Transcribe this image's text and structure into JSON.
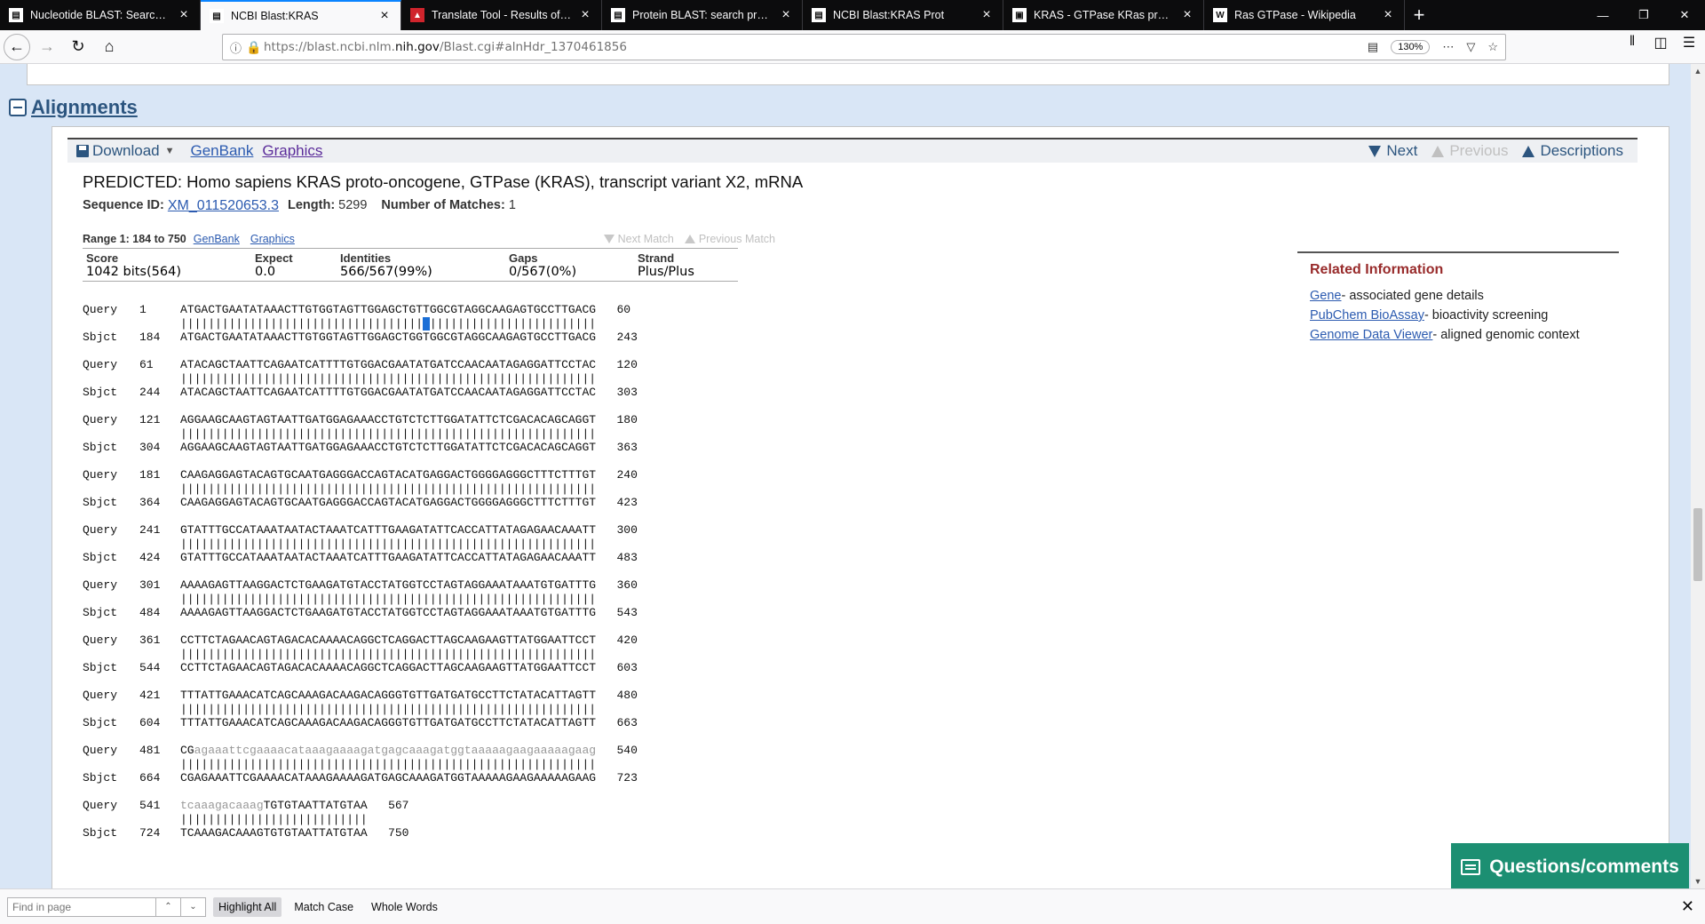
{
  "tabs": [
    {
      "label": "Nucleotide BLAST: Search nucl",
      "icon": "document-icon",
      "active": false
    },
    {
      "label": "NCBI Blast:KRAS",
      "icon": "document-icon",
      "active": true
    },
    {
      "label": "Translate Tool - Results of trans",
      "icon": "expasy-icon",
      "active": false
    },
    {
      "label": "Protein BLAST: search protein d",
      "icon": "document-icon",
      "active": false
    },
    {
      "label": "NCBI Blast:KRAS Prot",
      "icon": "document-icon",
      "active": false
    },
    {
      "label": "KRAS - GTPase KRas precursor",
      "icon": "uniprot-icon",
      "active": false
    },
    {
      "label": "Ras GTPase - Wikipedia",
      "icon": "wikipedia-icon",
      "active": false
    }
  ],
  "browser": {
    "url_prefix": "https://blast.ncbi.nlm.",
    "url_domain": "nih.gov",
    "url_suffix": "/Blast.cgi#alnHdr_1370461856",
    "zoom": "130%"
  },
  "page": {
    "section_title": "Alignments",
    "toolbar": {
      "download": "Download",
      "genbank": "GenBank",
      "graphics": "Graphics",
      "next": "Next",
      "previous": "Previous",
      "descriptions": "Descriptions"
    },
    "seq_title": "PREDICTED: Homo sapiens KRAS proto-oncogene, GTPase (KRAS), transcript variant X2, mRNA",
    "seq_id_label": "Sequence ID:",
    "seq_id": "XM_011520653.3",
    "length_label": "Length:",
    "length": "5299",
    "matches_label": "Number of Matches:",
    "matches": "1",
    "range_label": "Range 1: 184 to 750",
    "range_genbank": "GenBank",
    "range_graphics": "Graphics",
    "next_match": "Next Match",
    "previous_match": "Previous Match",
    "score_headers": [
      "Score",
      "Expect",
      "Identities",
      "Gaps",
      "Strand"
    ],
    "score_values": [
      "1042 bits(564)",
      "0.0",
      "566/567(99%)",
      "0/567(0%)",
      "Plus/Plus"
    ]
  },
  "alignment": [
    {
      "q_start": "1",
      "q_seq": "ATGACTGAATATAAACTTGTGGTAGTTGGAGCTGTTGGCGTAGGCAAGAGTGCCTTGACG",
      "q_end": "60",
      "mid": "||||||||||||||||||||||||||||||||||| ||||||||||||||||||||||||",
      "s_start": "184",
      "s_seq": "ATGACTGAATATAAACTTGTGGTAGTTGGAGCTGGTGGCGTAGGCAAGAGTGCCTTGACG",
      "s_end": "243"
    },
    {
      "q_start": "61",
      "q_seq": "ATACAGCTAATTCAGAATCATTTTGTGGACGAATATGATCCAACAATAGAGGATTCCTAC",
      "q_end": "120",
      "mid": "||||||||||||||||||||||||||||||||||||||||||||||||||||||||||||",
      "s_start": "244",
      "s_seq": "ATACAGCTAATTCAGAATCATTTTGTGGACGAATATGATCCAACAATAGAGGATTCCTAC",
      "s_end": "303"
    },
    {
      "q_start": "121",
      "q_seq": "AGGAAGCAAGTAGTAATTGATGGAGAAACCTGTCTCTTGGATATTCTCGACACAGCAGGT",
      "q_end": "180",
      "mid": "||||||||||||||||||||||||||||||||||||||||||||||||||||||||||||",
      "s_start": "304",
      "s_seq": "AGGAAGCAAGTAGTAATTGATGGAGAAACCTGTCTCTTGGATATTCTCGACACAGCAGGT",
      "s_end": "363"
    },
    {
      "q_start": "181",
      "q_seq": "CAAGAGGAGTACAGTGCAATGAGGGACCAGTACATGAGGACTGGGGAGGGCTTTCTTTGT",
      "q_end": "240",
      "mid": "||||||||||||||||||||||||||||||||||||||||||||||||||||||||||||",
      "s_start": "364",
      "s_seq": "CAAGAGGAGTACAGTGCAATGAGGGACCAGTACATGAGGACTGGGGAGGGCTTTCTTTGT",
      "s_end": "423"
    },
    {
      "q_start": "241",
      "q_seq": "GTATTTGCCATAAATAATACTAAATCATTTGAAGATATTCACCATTATAGAGAACAAATT",
      "q_end": "300",
      "mid": "||||||||||||||||||||||||||||||||||||||||||||||||||||||||||||",
      "s_start": "424",
      "s_seq": "GTATTTGCCATAAATAATACTAAATCATTTGAAGATATTCACCATTATAGAGAACAAATT",
      "s_end": "483"
    },
    {
      "q_start": "301",
      "q_seq": "AAAAGAGTTAAGGACTCTGAAGATGTACCTATGGTCCTAGTAGGAAATAAATGTGATTTG",
      "q_end": "360",
      "mid": "||||||||||||||||||||||||||||||||||||||||||||||||||||||||||||",
      "s_start": "484",
      "s_seq": "AAAAGAGTTAAGGACTCTGAAGATGTACCTATGGTCCTAGTAGGAAATAAATGTGATTTG",
      "s_end": "543"
    },
    {
      "q_start": "361",
      "q_seq": "CCTTCTAGAACAGTAGACACAAAACAGGCTCAGGACTTAGCAAGAAGTTATGGAATTCCT",
      "q_end": "420",
      "mid": "||||||||||||||||||||||||||||||||||||||||||||||||||||||||||||",
      "s_start": "544",
      "s_seq": "CCTTCTAGAACAGTAGACACAAAACAGGCTCAGGACTTAGCAAGAAGTTATGGAATTCCT",
      "s_end": "603"
    },
    {
      "q_start": "421",
      "q_seq": "TTTATTGAAACATCAGCAAAGACAAGACAGGGTGTTGATGATGCCTTCTATACATTAGTT",
      "q_end": "480",
      "mid": "||||||||||||||||||||||||||||||||||||||||||||||||||||||||||||",
      "s_start": "604",
      "s_seq": "TTTATTGAAACATCAGCAAAGACAAGACAGGGTGTTGATGATGCCTTCTATACATTAGTT",
      "s_end": "663"
    },
    {
      "q_start": "481",
      "q_upper": "CG",
      "q_lower": "agaaattcgaaaacataaagaaaagatgagcaaagatggtaaaaagaagaaaaagaag",
      "q_end": "540",
      "mid": "||||||||||||||||||||||||||||||||||||||||||||||||||||||||||||",
      "s_start": "664",
      "s_seq": "CGAGAAATTCGAAAACATAAAGAAAAGATGAGCAAAGATGGTAAAAAGAAGAAAAAGAAG",
      "s_end": "723"
    },
    {
      "q_start": "541",
      "q_lower": "tcaaagacaaag",
      "q_upper_end": "TGTGTAATTATGTAA",
      "q_end": "567",
      "mid": "|||||||||||||||||||||||||||",
      "s_start": "724",
      "s_seq": "TCAAAGACAAAGTGTGTAATTATGTAA",
      "s_end": "750"
    }
  ],
  "labels": {
    "query": "Query",
    "sbjct": "Sbjct"
  },
  "related": {
    "title": "Related Information",
    "items": [
      {
        "link": "Gene",
        "desc": "- associated gene details"
      },
      {
        "link": "PubChem BioAssay",
        "desc": "- bioactivity screening"
      },
      {
        "link": "Genome Data Viewer",
        "desc": "- aligned genomic context"
      }
    ]
  },
  "questions_button": "Questions/comments",
  "findbar": {
    "placeholder": "Find in page",
    "highlight_all": "Highlight All",
    "match_case": "Match Case",
    "whole_words": "Whole Words"
  },
  "colors": {
    "ncbi_blue": "#2c557f",
    "link": "#2c5bb0",
    "related_title": "#982b2b",
    "feedback_green": "#1c8f72"
  }
}
